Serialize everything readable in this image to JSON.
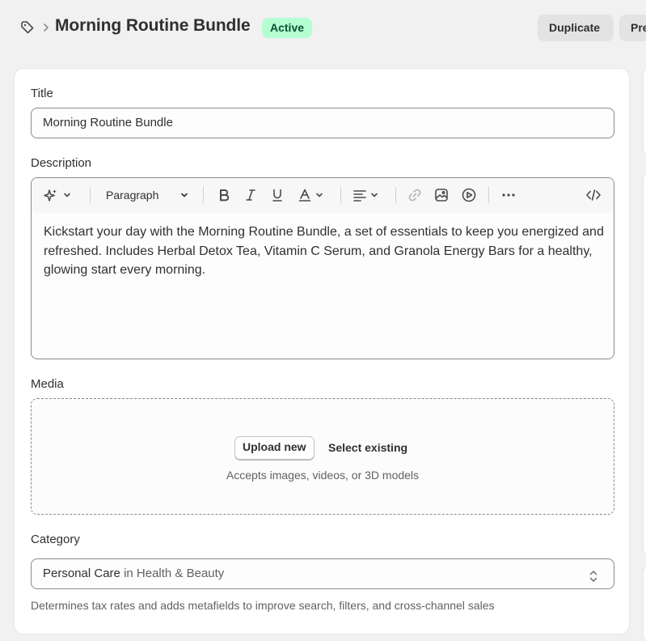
{
  "header": {
    "breadcrumb_icon": "tag-icon",
    "separator_icon": "chevron-right-icon",
    "title": "Morning Routine Bundle",
    "status": "Active",
    "duplicate_label": "Duplicate",
    "preview_label": "Pre"
  },
  "form": {
    "title_label": "Title",
    "title_value": "Morning Routine Bundle",
    "description_label": "Description",
    "toolbar": {
      "ai_icon": "sparkle-icon",
      "format_value": "Paragraph",
      "icons": [
        "bold-icon",
        "italic-icon",
        "underline-icon",
        "text-color-icon",
        "align-icon",
        "link-icon",
        "image-icon",
        "video-icon",
        "more-icon",
        "code-icon"
      ]
    },
    "description_text": "Kickstart your day with the Morning Routine Bundle, a set of essentials to keep you energized and refreshed. Includes Herbal Detox Tea, Vitamin C Serum, and Granola Energy Bars for a healthy, glowing start every morning.",
    "media_label": "Media",
    "upload_label": "Upload new",
    "select_existing_label": "Select existing",
    "media_hint": "Accepts images, videos, or 3D models",
    "category_label": "Category",
    "category_value": "Personal Care",
    "category_path": "in Health & Beauty",
    "category_helper": "Determines tax rates and adds metafields to improve search, filters, and cross-channel sales"
  },
  "colors": {
    "background": "#f1f1f1",
    "card": "#ffffff",
    "badge_bg": "#b4fed2",
    "badge_text": "#0c5132",
    "button_bg": "#e3e3e3"
  }
}
